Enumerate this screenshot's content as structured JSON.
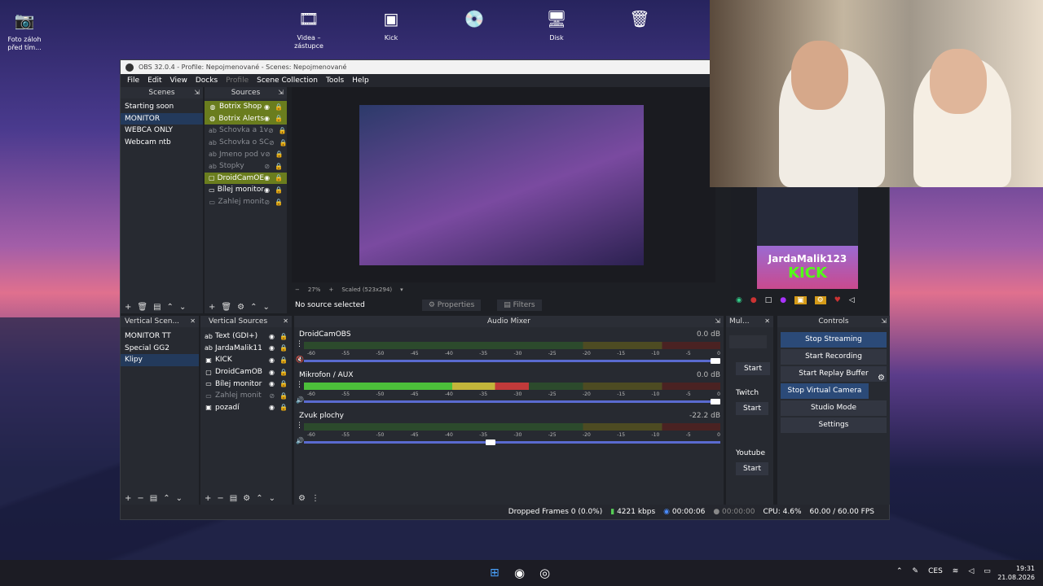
{
  "desktop": {
    "icons": [
      {
        "label": "Foto záloh před tím...",
        "icon": "camera-icon",
        "glyph": "📷"
      },
      {
        "label": "Videa – zástupce",
        "icon": "video-folder-icon",
        "glyph": "🎞"
      },
      {
        "label": "Kick",
        "icon": "kick-icon",
        "glyph": "▣"
      },
      {
        "label": "",
        "icon": "disc-icon",
        "glyph": "💿"
      },
      {
        "label": "Disk",
        "icon": "computer-icon",
        "glyph": "🖥"
      },
      {
        "label": "",
        "icon": "recycle-bin-icon",
        "glyph": "🗑"
      }
    ]
  },
  "obs": {
    "title": "OBS 32.0.4 - Profile: Nepojmenované - Scenes: Nepojmenované",
    "menu": [
      "File",
      "Edit",
      "View",
      "Docks",
      "Profile",
      "Scene Collection",
      "Tools",
      "Help"
    ],
    "scenes": {
      "header": "Scenes",
      "items": [
        "Starting soon",
        "MONITOR",
        "WEBCA ONLY",
        "Webcam ntb"
      ],
      "selected": 1
    },
    "sources": {
      "header": "Sources",
      "items": [
        {
          "name": "Botrix Shop",
          "icon": "browser",
          "hl": true
        },
        {
          "name": "Botrix Alerts",
          "icon": "browser",
          "hl": true
        },
        {
          "name": "Schovka a 1v",
          "icon": "text",
          "dim": true
        },
        {
          "name": "Schovka o SC",
          "icon": "text",
          "dim": true
        },
        {
          "name": "Jmeno pod v",
          "icon": "text",
          "dim": true
        },
        {
          "name": "Stopky",
          "icon": "text",
          "dim": true
        },
        {
          "name": "DroidCamOE",
          "icon": "camera",
          "hl": true
        },
        {
          "name": "Bílej monitor",
          "icon": "display"
        },
        {
          "name": "Zahlej monit",
          "icon": "display",
          "dim": true
        }
      ]
    },
    "preview": {
      "zoom": "27%",
      "scaled": "Scaled (523x294)"
    },
    "no_source": "No source selected",
    "properties": "Properties",
    "filters": "Filters",
    "vscenes": {
      "header": "Vertical Scen...",
      "items": [
        "MONITOR TT",
        "Special GG2",
        "Klipy"
      ],
      "selected": 2
    },
    "vsources": {
      "header": "Vertical Sources",
      "items": [
        {
          "name": "Text (GDI+)",
          "icon": "text"
        },
        {
          "name": "JardaMalik11",
          "icon": "text"
        },
        {
          "name": "KICK",
          "icon": "image"
        },
        {
          "name": "DroidCamOB",
          "icon": "camera"
        },
        {
          "name": "Bílej monitor",
          "icon": "display"
        },
        {
          "name": "Zahlej monit",
          "icon": "display",
          "dim": true
        },
        {
          "name": "pozadí",
          "icon": "image"
        }
      ]
    },
    "mixer": {
      "header": "Audio Mixer",
      "scale": [
        "-60",
        "-55",
        "-50",
        "-45",
        "-40",
        "-35",
        "-30",
        "-25",
        "-20",
        "-15",
        "-10",
        "-5",
        "0"
      ],
      "channels": [
        {
          "name": "DroidCamOBS",
          "db": "0.0 dB",
          "level": 0,
          "vol": 1.0,
          "muted": true
        },
        {
          "name": "Mikrofon / AUX",
          "db": "0.0 dB",
          "level": 0.54,
          "vol": 1.0,
          "muted": false
        },
        {
          "name": "Zvuk plochy",
          "db": "-22.2 dB",
          "level": 0,
          "vol": 0.46,
          "muted": false
        }
      ]
    },
    "multi": {
      "header": "Mul...",
      "start": "Start",
      "twitch": "Twitch",
      "youtube": "Youtube"
    },
    "controls": {
      "header": "Controls",
      "buttons": [
        "Stop Streaming",
        "Start Recording",
        "Start Replay Buffer",
        "Stop Virtual Camera",
        "Studio Mode",
        "Settings"
      ]
    },
    "status": {
      "dropped": "Dropped Frames 0 (0.0%)",
      "kbps": "4221 kbps",
      "live": "00:00:06",
      "rec": "00:00:00",
      "cpu": "CPU: 4.6%",
      "fps": "60.00 / 60.00 FPS"
    }
  },
  "overlay": {
    "name": "JardaMalik123",
    "brand": "KICK"
  },
  "taskbar": {
    "lang": "CES",
    "time": "19:31",
    "date": "21.08.2026"
  }
}
